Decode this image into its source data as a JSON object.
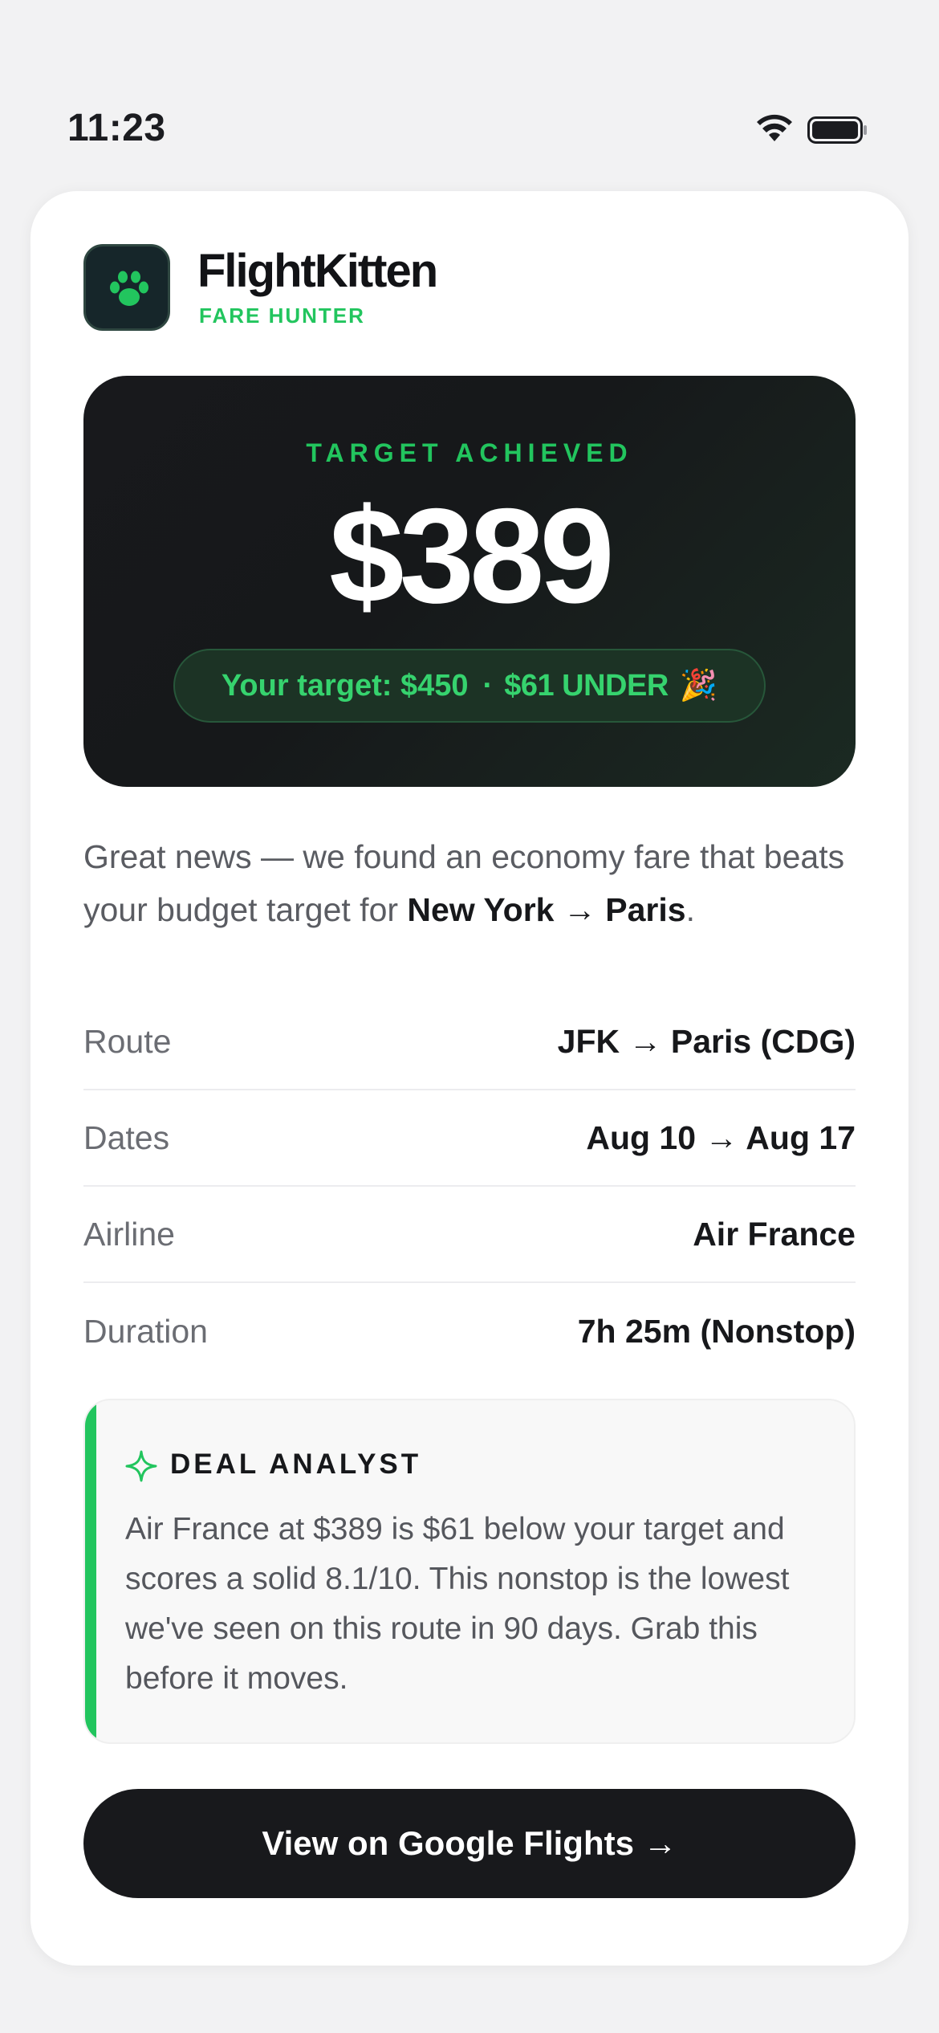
{
  "status_bar": {
    "time": "11:23",
    "icons": [
      "wifi-icon",
      "battery-icon"
    ]
  },
  "brand": {
    "name": "FlightKitten",
    "tagline": "FARE HUNTER",
    "logo_icon": "paw-icon"
  },
  "hero": {
    "eyebrow": "TARGET ACHIEVED",
    "price": "$389",
    "target_text": "Your target: $450",
    "separator": "·",
    "under_text": "$61 UNDER",
    "emoji": "🎉"
  },
  "intro": {
    "text": "Great news — we found an economy fare that beats your budget target for ",
    "route": "New York → Paris",
    "end": "."
  },
  "details": [
    {
      "label": "Route",
      "value": "JFK → Paris (CDG)"
    },
    {
      "label": "Dates",
      "value": "Aug 10 → Aug 17"
    },
    {
      "label": "Airline",
      "value": "Air France"
    },
    {
      "label": "Duration",
      "value": "7h 25m (Nonstop)"
    }
  ],
  "analyst": {
    "icon": "sparkle-icon",
    "title": "DEAL ANALYST",
    "body": "Air France at $389 is $61 below your target and scores a solid 8.1/10. This nonstop is the lowest we've seen on this route in 90 days. Grab this before it moves."
  },
  "cta": {
    "label": "View on Google Flights →"
  },
  "colors": {
    "accent": "#22c55e",
    "dark": "#18191c",
    "background": "#f2f2f3"
  }
}
